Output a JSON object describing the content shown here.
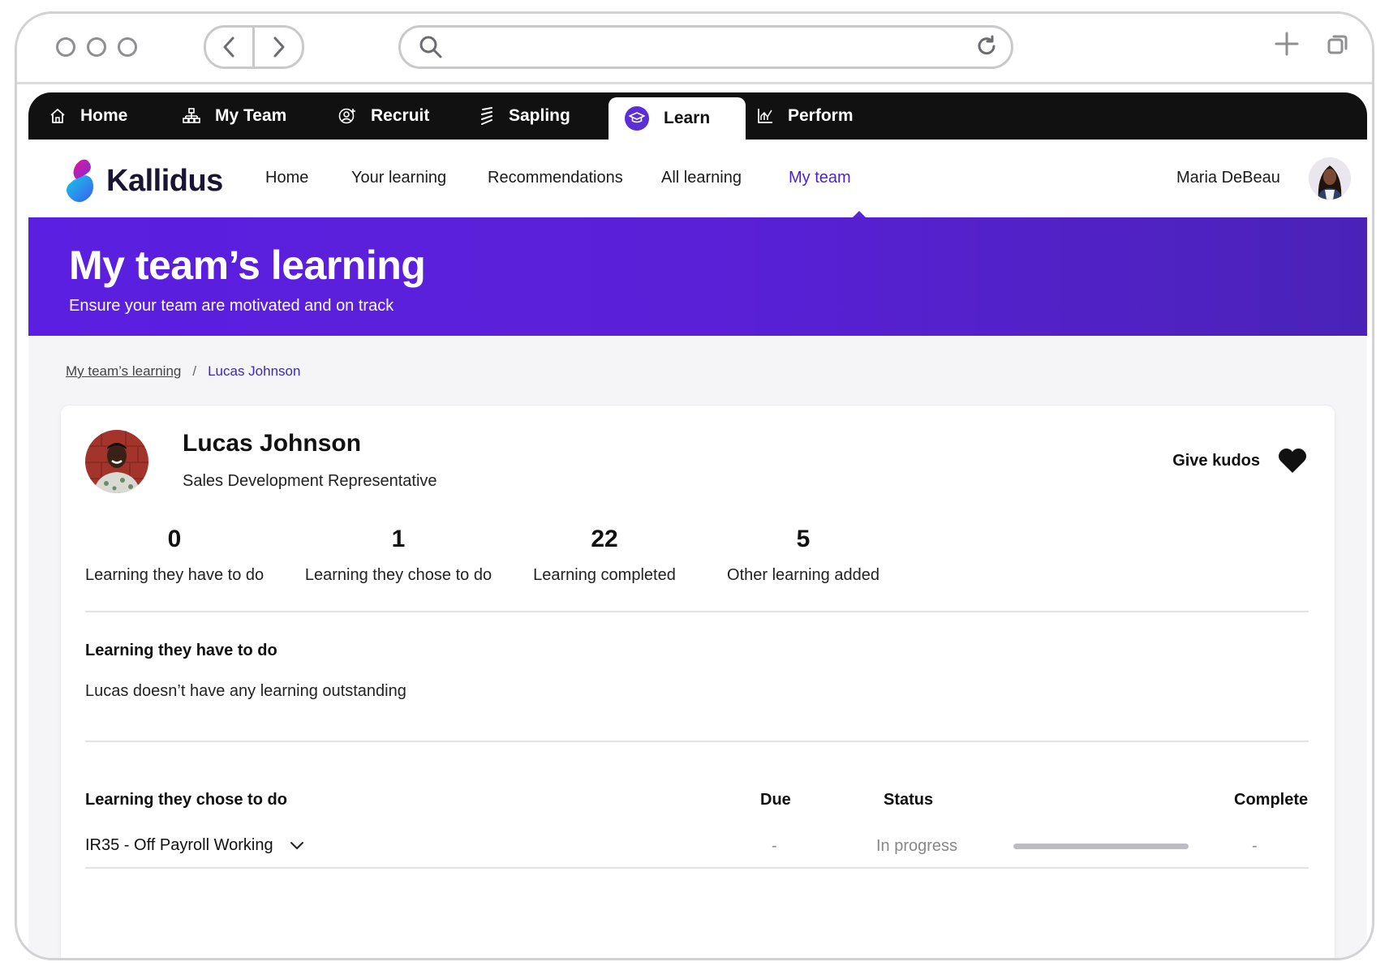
{
  "suite_nav": {
    "items": [
      {
        "label": "Home",
        "icon": "house-icon"
      },
      {
        "label": "My Team",
        "icon": "org-chart-icon"
      },
      {
        "label": "Recruit",
        "icon": "recruit-icon"
      },
      {
        "label": "Sapling",
        "icon": "sapling-icon"
      },
      {
        "label": "Learn",
        "icon": "graduation-cap-icon",
        "active": true
      },
      {
        "label": "Perform",
        "icon": "chart-icon"
      }
    ]
  },
  "app_header": {
    "logo_text": "Kallidus",
    "nav": [
      "Home",
      "Your learning",
      "Recommendations",
      "All learning",
      "My team"
    ],
    "active_nav": "My team",
    "user_name": "Maria DeBeau"
  },
  "hero": {
    "title": "My team’s learning",
    "subtitle": "Ensure your team are motivated and on track"
  },
  "breadcrumb": {
    "parent": "My team’s learning",
    "separator": "/",
    "current": "Lucas Johnson"
  },
  "profile": {
    "name": "Lucas Johnson",
    "role": "Sales Development Representative",
    "kudos_label": "Give kudos"
  },
  "stats": [
    {
      "value": "0",
      "label": "Learning they have to do"
    },
    {
      "value": "1",
      "label": "Learning they chose to do"
    },
    {
      "value": "22",
      "label": "Learning completed"
    },
    {
      "value": "5",
      "label": "Other learning added"
    }
  ],
  "required_section": {
    "title": "Learning they have to do",
    "empty_text": "Lucas doesn’t have any learning outstanding"
  },
  "chosen_section": {
    "title": "Learning they chose to do",
    "columns": {
      "due": "Due",
      "status": "Status",
      "complete": "Complete"
    },
    "rows": [
      {
        "title": "IR35 - Off Payroll Working",
        "due": "-",
        "status": "In progress",
        "progress": 1.0,
        "complete": "-"
      }
    ]
  },
  "colors": {
    "accent": "#5b2ed6",
    "hero_start": "#5a1fe0",
    "hero_end": "#4a22b8",
    "suite_bar": "#111111"
  }
}
